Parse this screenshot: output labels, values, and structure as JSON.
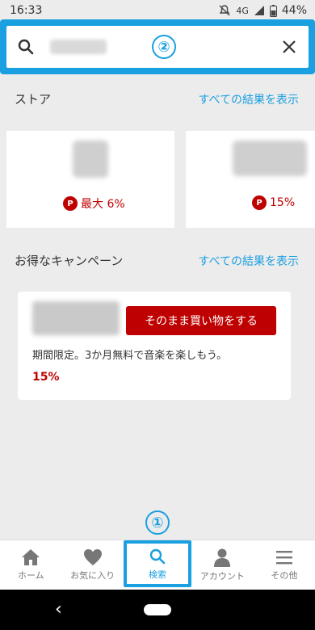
{
  "status_bar": {
    "time": "16:33",
    "network": "4G",
    "battery": "44%"
  },
  "search": {
    "annotation": "②"
  },
  "stores": {
    "title": "ストア",
    "see_all": "すべての結果を表示",
    "items": [
      {
        "points": "最大 6%",
        "badge": "P"
      },
      {
        "points": "15%",
        "badge": "P"
      }
    ]
  },
  "campaigns": {
    "title": "お得なキャンペーン",
    "see_all": "すべての結果を表示",
    "items": [
      {
        "button": "そのまま買い物をする",
        "description": "期間限定。3か月無料で音楽を楽しもう。",
        "points": "15%"
      }
    ]
  },
  "annotation_bottom": "①",
  "tabs": [
    {
      "label": "ホーム",
      "icon": "home-icon"
    },
    {
      "label": "お気に入り",
      "icon": "heart-icon"
    },
    {
      "label": "検索",
      "icon": "search-icon",
      "active": true
    },
    {
      "label": "アカウント",
      "icon": "person-icon"
    },
    {
      "label": "その他",
      "icon": "menu-icon"
    }
  ],
  "colors": {
    "accent": "#1a9fe0",
    "brand_red": "#bf0000",
    "background": "#ececec"
  }
}
